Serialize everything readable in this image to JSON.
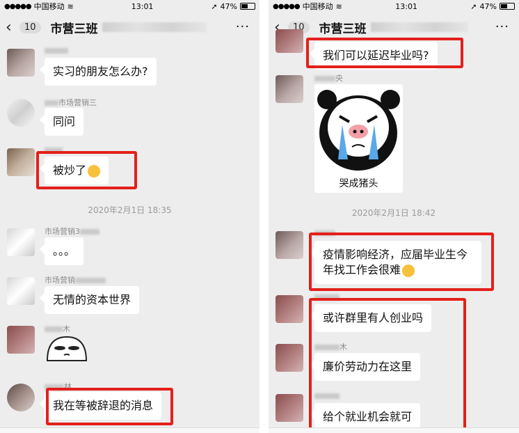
{
  "status": {
    "carrier": "中国移动",
    "time": "13:01",
    "battery": "47%"
  },
  "nav": {
    "badge": "10",
    "title": "市营三班",
    "more": "···"
  },
  "left": {
    "m1": {
      "text": "实习的朋友怎么办?"
    },
    "m2": {
      "sender": "市场营销三",
      "text": "同问"
    },
    "m3": {
      "text": "被炒了"
    },
    "time1": "2020年2月1日 18:35",
    "m4": {
      "sender": "市场营销3",
      "text": "。。。"
    },
    "m5": {
      "sender": "市场营销",
      "text": "无情的资本世界"
    },
    "m6": {
      "sender": "木"
    },
    "m7": {
      "sender": "林",
      "text": "我在等被辞退的消息"
    }
  },
  "right": {
    "m1": {
      "text": "我们可以延迟毕业吗?"
    },
    "m2": {
      "sender": "央",
      "sticker_caption": "哭成猪头"
    },
    "time1": "2020年2月1日 18:42",
    "m3": {
      "text": "疫情影响经济，应届毕业生今年找工作会很难"
    },
    "m4": {
      "text": "或许群里有人创业吗"
    },
    "m5": {
      "sender": "木",
      "text": "廉价劳动力在这里"
    },
    "m6": {
      "text": "给个就业机会就可"
    }
  },
  "colors": {
    "highlight": "#e3201b",
    "background": "#ededed",
    "bubble": "#ffffff"
  }
}
